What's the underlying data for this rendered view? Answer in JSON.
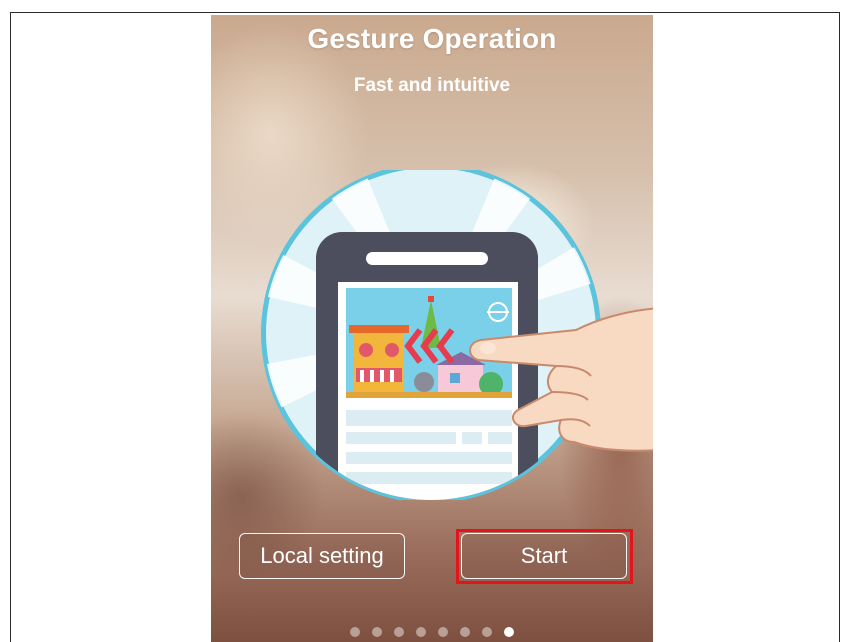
{
  "screen": {
    "title": "Gesture Operation",
    "subtitle": "Fast and intuitive"
  },
  "illustration": {
    "icon": "phone-swipe-gesture-illustration",
    "circle_color": "#5bc3dc",
    "phone_color": "#4c4e5e"
  },
  "buttons": {
    "local_setting_label": "Local setting",
    "start_label": "Start"
  },
  "highlight": {
    "color": "#e3141c",
    "target": "start-button"
  },
  "pagination": {
    "total": 8,
    "current": 8
  }
}
